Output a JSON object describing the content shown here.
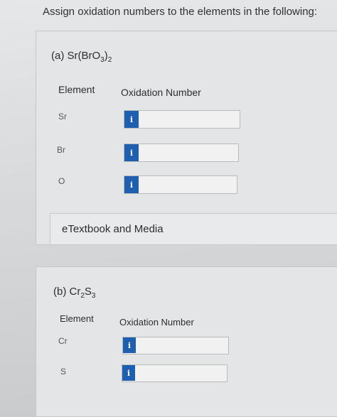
{
  "prompt": "Assign oxidation numbers to the elements in the following:",
  "part_a": {
    "label_prefix": "(a) Sr(BrO",
    "label_sub1": "3",
    "label_mid": ")",
    "label_sub2": "2",
    "col_element": "Element",
    "col_oxidation": "Oxidation Number",
    "rows": [
      {
        "element": "Sr",
        "icon": "i",
        "value": ""
      },
      {
        "element": "Br",
        "icon": "i",
        "value": ""
      },
      {
        "element": "O",
        "icon": "i",
        "value": ""
      }
    ]
  },
  "media_link": "eTextbook and Media",
  "part_b": {
    "label_prefix": "(b) Cr",
    "label_sub1": "2",
    "label_mid": "S",
    "label_sub2": "3",
    "col_element": "Element",
    "col_oxidation": "Oxidation Number",
    "rows": [
      {
        "element": "Cr",
        "icon": "i",
        "value": ""
      },
      {
        "element": "S",
        "icon": "i",
        "value": ""
      }
    ]
  },
  "colors": {
    "info_icon_bg": "#1f5fb0"
  }
}
